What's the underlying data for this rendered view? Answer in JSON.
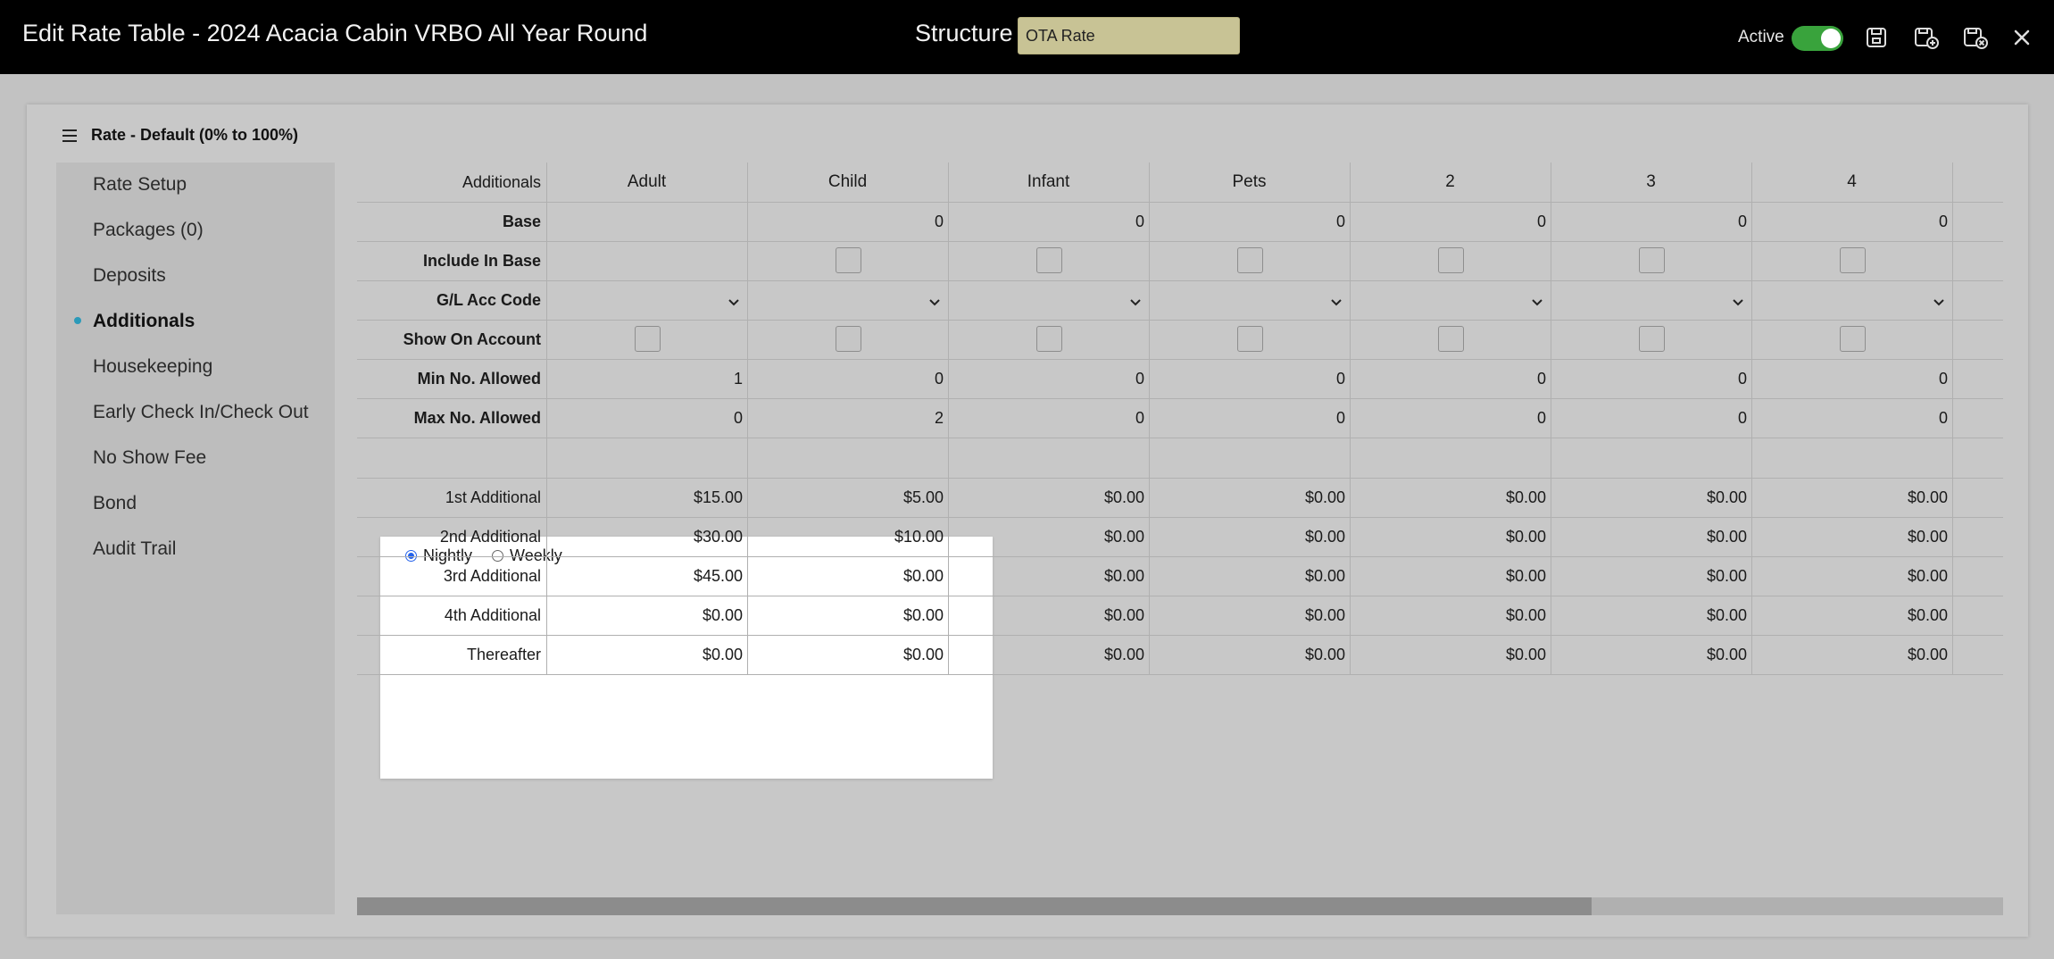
{
  "header": {
    "title": "Edit Rate Table - 2024 Acacia Cabin VRBO All Year Round",
    "structure_label": "Structure",
    "structure_value": "OTA Rate",
    "active_label": "Active",
    "active_on": true,
    "icons": [
      "save-icon",
      "save-and-new-icon",
      "save-and-close-icon",
      "close-icon"
    ]
  },
  "panel": {
    "title": "Rate - Default (0% to 100%)"
  },
  "sidebar": {
    "items": [
      {
        "label": "Rate Setup",
        "active": false
      },
      {
        "label": "Packages (0)",
        "active": false
      },
      {
        "label": "Deposits",
        "active": false
      },
      {
        "label": "Additionals",
        "active": true
      },
      {
        "label": "Housekeeping",
        "active": false
      },
      {
        "label": "Early Check In/Check Out",
        "active": false
      },
      {
        "label": "No Show Fee",
        "active": false
      },
      {
        "label": "Bond",
        "active": false
      },
      {
        "label": "Audit Trail",
        "active": false
      }
    ]
  },
  "grid": {
    "columns": [
      "Additionals",
      "Adult",
      "Child",
      "Infant",
      "Pets",
      "2",
      "3",
      "4"
    ],
    "base": {
      "label": "Base",
      "values": [
        "",
        "0",
        "0",
        "0",
        "0",
        "0",
        "0"
      ]
    },
    "include_in_base": {
      "label": "Include In Base",
      "checked": [
        null,
        false,
        false,
        false,
        false,
        false,
        false
      ]
    },
    "gl_acc_code": {
      "label": "G/L Acc Code"
    },
    "show_on_account": {
      "label": "Show On Account",
      "checked": [
        false,
        false,
        false,
        false,
        false,
        false,
        false
      ]
    },
    "min_allowed": {
      "label": "Min No. Allowed",
      "values": [
        "1",
        "0",
        "0",
        "0",
        "0",
        "0",
        "0"
      ]
    },
    "max_allowed": {
      "label": "Max No. Allowed",
      "values": [
        "0",
        "2",
        "0",
        "0",
        "0",
        "0",
        "0"
      ]
    },
    "period": {
      "options": [
        "Nightly",
        "Weekly"
      ],
      "selected": "Nightly"
    },
    "additional_rows": [
      {
        "label": "1st Additional",
        "values": [
          "$15.00",
          "$5.00",
          "$0.00",
          "$0.00",
          "$0.00",
          "$0.00",
          "$0.00"
        ]
      },
      {
        "label": "2nd Additional",
        "values": [
          "$30.00",
          "$10.00",
          "$0.00",
          "$0.00",
          "$0.00",
          "$0.00",
          "$0.00"
        ]
      },
      {
        "label": "3rd Additional",
        "values": [
          "$45.00",
          "$0.00",
          "$0.00",
          "$0.00",
          "$0.00",
          "$0.00",
          "$0.00"
        ]
      },
      {
        "label": "4th Additional",
        "values": [
          "$0.00",
          "$0.00",
          "$0.00",
          "$0.00",
          "$0.00",
          "$0.00",
          "$0.00"
        ]
      },
      {
        "label": "Thereafter",
        "values": [
          "$0.00",
          "$0.00",
          "$0.00",
          "$0.00",
          "$0.00",
          "$0.00",
          "$0.00"
        ]
      }
    ],
    "horizontal_scroll_fraction": 0.75
  }
}
